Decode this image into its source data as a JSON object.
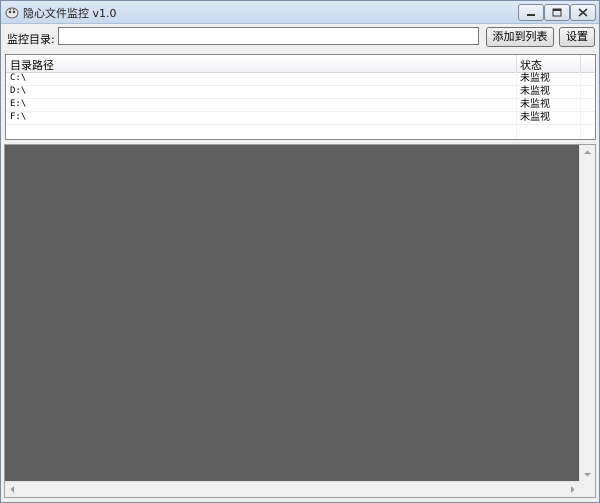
{
  "window": {
    "title": "隐心文件监控 v1.0",
    "icons": {
      "app": "app-icon",
      "minimize": "minimize-icon",
      "maximize": "maximize-icon",
      "close": "close-icon"
    }
  },
  "toolbar": {
    "dir_label": "监控目录:",
    "dir_input_value": "",
    "add_button": "添加到列表",
    "settings_button": "设置"
  },
  "list": {
    "columns": [
      "目录路径",
      "状态"
    ],
    "rows": [
      {
        "path": "C:\\",
        "status": "未监视"
      },
      {
        "path": "D:\\",
        "status": "未监视"
      },
      {
        "path": "E:\\",
        "status": "未监视"
      },
      {
        "path": "F:\\",
        "status": "未监视"
      }
    ]
  },
  "log": {
    "background": "#5f5f5f"
  }
}
